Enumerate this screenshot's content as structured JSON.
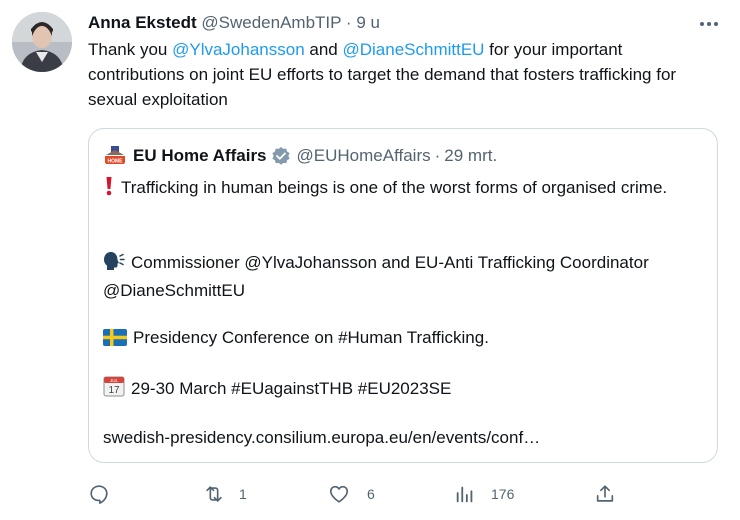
{
  "author": {
    "name": "Anna Ekstedt",
    "handle": "@SwedenAmbTIP",
    "time": "9 u"
  },
  "tweet": {
    "parts": {
      "p1": "Thank you ",
      "m1": "@YlvaJohansson",
      "p2": " and ",
      "m2": "@DianeSchmittEU",
      "p3": " for your important contributions on joint EU efforts to target the demand that fosters trafficking for sexual exploitation"
    }
  },
  "quote": {
    "name": "EU Home Affairs",
    "handle": "@EUHomeAffairs",
    "time": "29 mrt.",
    "avatar_text": "HOME",
    "lines": {
      "l1": "Trafficking in human beings is one of the worst forms of organised crime.",
      "l2": "Commissioner @YlvaJohansson and EU-Anti Trafficking Coordinator @DianeSchmittEU",
      "l3": "Presidency Conference on #Human Trafficking.",
      "l4": "29-30 March #EUagainstTHB #EU2023SE",
      "l5": "swedish-presidency.consilium.europa.eu/en/events/conf…"
    },
    "emoji": {
      "e1": "exclamation-icon",
      "e2": "speaking-head-icon",
      "e3": "swedish-flag-icon",
      "e4": "calendar-icon"
    },
    "calendar": {
      "month": "JUL",
      "day": "17"
    }
  },
  "actions": {
    "reply": {
      "icon": "reply-icon",
      "count": ""
    },
    "retweet": {
      "icon": "retweet-icon",
      "count": "1"
    },
    "like": {
      "icon": "heart-icon",
      "count": "6"
    },
    "views": {
      "icon": "views-icon",
      "count": "176"
    },
    "share": {
      "icon": "share-icon",
      "count": ""
    }
  },
  "colors": {
    "accent": "#1d9bf0",
    "text": "#0f1419",
    "muted": "#536471",
    "border": "#cfd9de"
  }
}
